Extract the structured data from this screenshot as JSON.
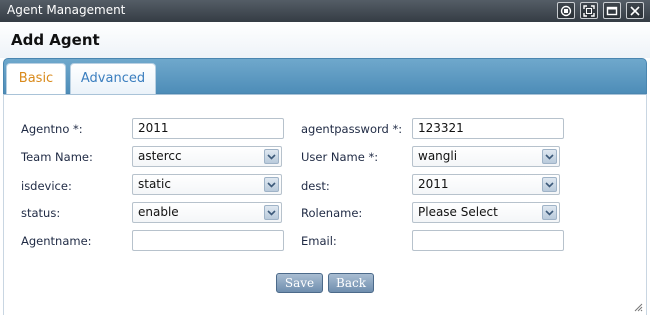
{
  "window": {
    "title": "Agent Management",
    "controls": [
      "restore-icon",
      "maximize-icon",
      "minimize-icon",
      "close-icon"
    ]
  },
  "header": {
    "title": "Add Agent"
  },
  "tabs": [
    {
      "label": "Basic",
      "active": true
    },
    {
      "label": "Advanced",
      "active": false
    }
  ],
  "form": {
    "agentno": {
      "label": "Agentno *:",
      "value": "2011"
    },
    "agentpassword": {
      "label": "agentpassword *:",
      "value": "123321"
    },
    "team_name": {
      "label": "Team Name:",
      "value": "astercc"
    },
    "user_name": {
      "label": "User Name *:",
      "value": "wangli"
    },
    "isdevice": {
      "label": "isdevice:",
      "value": "static"
    },
    "dest": {
      "label": "dest:",
      "value": "2011"
    },
    "status": {
      "label": "status:",
      "value": "enable"
    },
    "rolename": {
      "label": "Rolename:",
      "value": "Please Select"
    },
    "agentname": {
      "label": "Agentname:",
      "value": ""
    },
    "email": {
      "label": "Email:",
      "value": ""
    }
  },
  "buttons": {
    "save": "Save",
    "back": "Back"
  },
  "colors": {
    "titlebar": "#3f474f",
    "tabbar": "#5b97c2",
    "active_tab_text": "#d98a1c",
    "inactive_tab_text": "#3a7ebf",
    "button": "#7f9cba"
  }
}
